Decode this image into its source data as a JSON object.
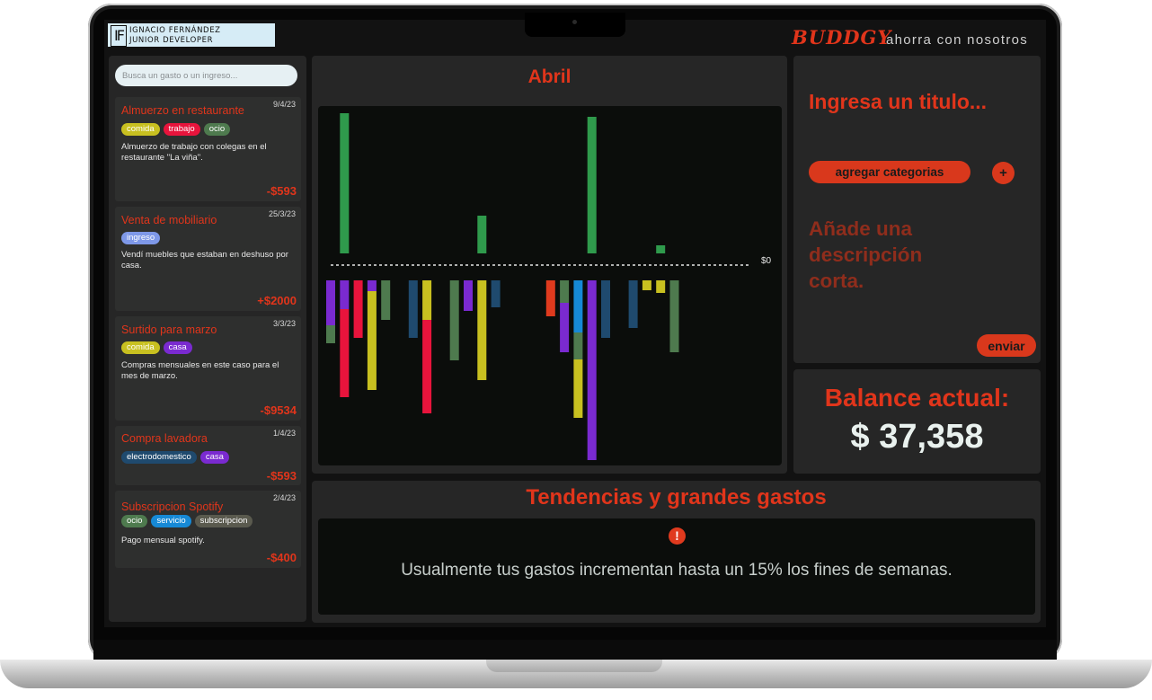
{
  "brand": {
    "monogram": "IF",
    "name_line1": "IGNACIO FERNÁNDEZ",
    "name_line2": "JUNIOR DEVELOPER"
  },
  "app": {
    "name": "BUDDGY",
    "tagline": "ahorra con nosotros",
    "accent_color": "#e1351b"
  },
  "sidebar": {
    "search_placeholder": "Busca un gasto o un ingreso...",
    "transactions": [
      {
        "title": "Almuerzo en restaurante",
        "date": "9/4/23",
        "tags": [
          {
            "label": "comida",
            "color": "#c8c020"
          },
          {
            "label": "trabajo",
            "color": "#e8143c"
          },
          {
            "label": "ocio",
            "color": "#4e7a4e"
          }
        ],
        "description": "Almuerzo de trabajo con colegas en el restaurante \"La viña\".",
        "amount": "-$593"
      },
      {
        "title": "Venta de mobiliario",
        "date": "25/3/23",
        "tags": [
          {
            "label": "ingreso",
            "color": "#7e98e8"
          }
        ],
        "description": "Vendí muebles que estaban en deshuso por casa.",
        "amount": "+$2000"
      },
      {
        "title": "Surtido para marzo",
        "date": "3/3/23",
        "tags": [
          {
            "label": "comida",
            "color": "#c8c020"
          },
          {
            "label": "casa",
            "color": "#7a2ad0"
          }
        ],
        "description": "Compras mensuales en este caso para el mes de marzo.",
        "amount": "-$9534"
      },
      {
        "title": "Compra lavadora",
        "date": "1/4/23",
        "tags": [
          {
            "label": "electrodomestico",
            "color": "#1f4a6e"
          },
          {
            "label": "casa",
            "color": "#7a2ad0"
          }
        ],
        "description": "",
        "amount": "-$593"
      },
      {
        "title": "Subscripcion Spotify",
        "date": "2/4/23",
        "tags": [
          {
            "label": "ocio",
            "color": "#4e7a4e"
          },
          {
            "label": "servicio",
            "color": "#1689d6"
          },
          {
            "label": "subscripcion",
            "color": "#5a5a4e"
          }
        ],
        "description": "Pago mensual spotify.",
        "amount": "-$400"
      }
    ]
  },
  "chart_panel": {
    "title": "Abril",
    "zero_label": "$0"
  },
  "chart_data": {
    "type": "bar",
    "title": "Abril",
    "xlabel": "",
    "ylabel": "",
    "baseline_label": "$0",
    "grid": false,
    "legend": "none",
    "income_bars": [
      {
        "day": 2,
        "value": 156,
        "color": "#2f9a4c"
      },
      {
        "day": 12,
        "value": 42,
        "color": "#2f9a4c"
      },
      {
        "day": 20,
        "value": 152,
        "color": "#2f9a4c"
      },
      {
        "day": 25,
        "value": 9,
        "color": "#2f9a4c"
      }
    ],
    "expense_days": [
      {
        "day": 1,
        "segments": [
          {
            "value": 50,
            "color": "#7a2ad0"
          },
          {
            "value": 20,
            "color": "#4e7a4e"
          }
        ]
      },
      {
        "day": 2,
        "segments": [
          {
            "value": 32,
            "color": "#7a2ad0"
          },
          {
            "value": 98,
            "color": "#e8143c"
          }
        ]
      },
      {
        "day": 3,
        "segments": [
          {
            "value": 64,
            "color": "#e8143c"
          }
        ]
      },
      {
        "day": 4,
        "segments": [
          {
            "value": 12,
            "color": "#7a2ad0"
          },
          {
            "value": 110,
            "color": "#c8c020"
          }
        ]
      },
      {
        "day": 5,
        "segments": [
          {
            "value": 44,
            "color": "#4e7a4e"
          }
        ]
      },
      {
        "day": 7,
        "segments": [
          {
            "value": 64,
            "color": "#1f4a6e"
          }
        ]
      },
      {
        "day": 8,
        "segments": [
          {
            "value": 44,
            "color": "#c8c020"
          },
          {
            "value": 104,
            "color": "#e8143c"
          }
        ]
      },
      {
        "day": 10,
        "segments": [
          {
            "value": 89,
            "color": "#4e7a4e"
          }
        ]
      },
      {
        "day": 11,
        "segments": [
          {
            "value": 34,
            "color": "#7a2ad0"
          }
        ]
      },
      {
        "day": 12,
        "segments": [
          {
            "value": 111,
            "color": "#c8c020"
          }
        ]
      },
      {
        "day": 13,
        "segments": [
          {
            "value": 30,
            "color": "#1f4a6e"
          }
        ]
      },
      {
        "day": 17,
        "segments": [
          {
            "value": 40,
            "color": "#e03a1e"
          }
        ]
      },
      {
        "day": 18,
        "segments": [
          {
            "value": 25,
            "color": "#4e7a4e"
          },
          {
            "value": 55,
            "color": "#7a2ad0"
          }
        ]
      },
      {
        "day": 19,
        "segments": [
          {
            "value": 58,
            "color": "#1689d6"
          },
          {
            "value": 30,
            "color": "#4e7a4e"
          },
          {
            "value": 65,
            "color": "#c8c020"
          }
        ]
      },
      {
        "day": 20,
        "segments": [
          {
            "value": 200,
            "color": "#7a2ad0"
          }
        ]
      },
      {
        "day": 21,
        "segments": [
          {
            "value": 64,
            "color": "#1f4a6e"
          }
        ]
      },
      {
        "day": 23,
        "segments": [
          {
            "value": 53,
            "color": "#1f4a6e"
          }
        ]
      },
      {
        "day": 24,
        "segments": [
          {
            "value": 11,
            "color": "#c8c020"
          }
        ]
      },
      {
        "day": 25,
        "segments": [
          {
            "value": 14,
            "color": "#c8c020"
          }
        ]
      },
      {
        "day": 26,
        "segments": [
          {
            "value": 80,
            "color": "#4e7a4e"
          }
        ]
      }
    ]
  },
  "form": {
    "title_placeholder": "Ingresa un titulo...",
    "add_categories_label": "agregar categorias",
    "add_icon": "+",
    "description_placeholder": "Añade una descripción corta.",
    "send_label": "enviar"
  },
  "balance": {
    "label": "Balance actual:",
    "value": "$ 37,358"
  },
  "trends": {
    "title": "Tendencias y grandes gastos",
    "alert_icon": "!",
    "message": "Usualmente tus gastos  incrementan hasta un 15% los fines de semanas."
  }
}
